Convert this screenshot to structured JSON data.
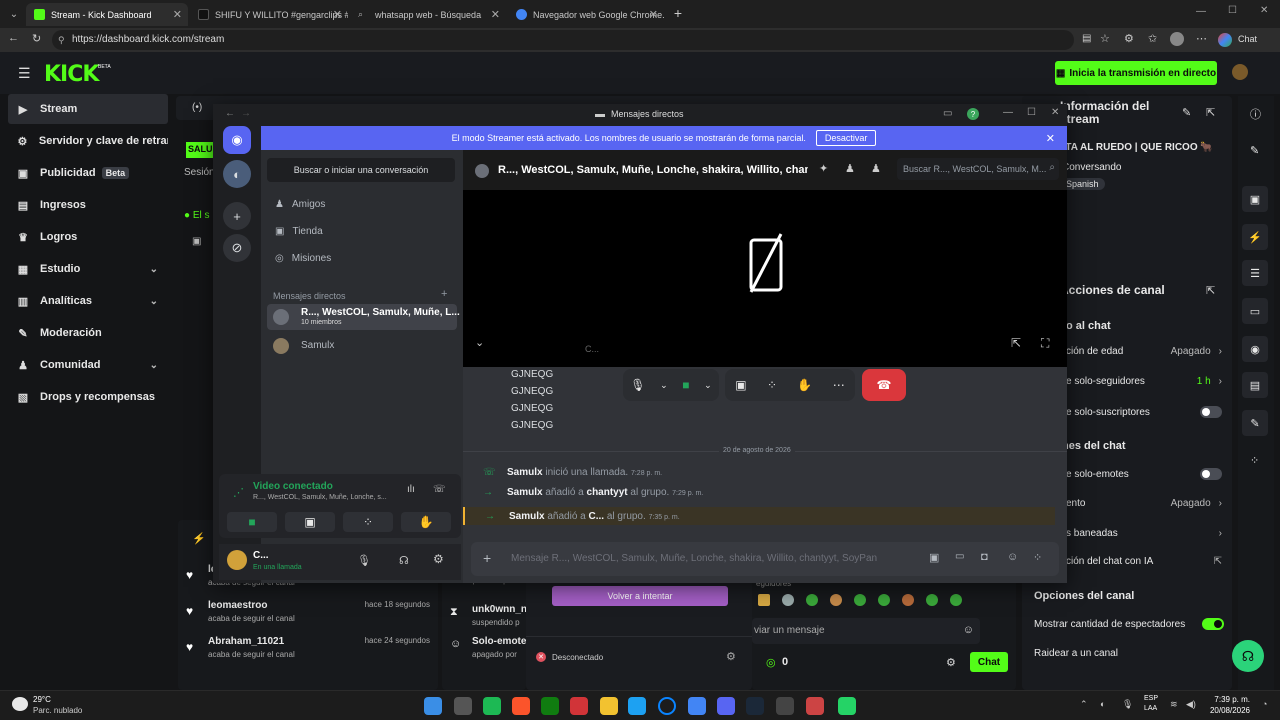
{
  "browser": {
    "tabs": [
      {
        "title": "Stream - Kick Dashboard",
        "color": "#53fc18"
      },
      {
        "title": "SHIFU Y WILLITO #gengarclips #...",
        "color": "#111111"
      },
      {
        "title": "whatsapp web - Búsqueda",
        "color": "#3c3c3c"
      },
      {
        "title": "Navegador web Google Chrome...",
        "color": "#4285f4"
      }
    ],
    "url": "https://dashboard.kick.com/stream",
    "chat_label": "Chat"
  },
  "kick": {
    "logo": "KICK",
    "logo_badge": "BETA",
    "go_live": "Inicia la transmisión en directo",
    "nav": [
      {
        "label": "Stream",
        "icon": "▶"
      },
      {
        "label": "Servidor y clave de retrans",
        "icon": "⚙"
      },
      {
        "label": "Publicidad",
        "icon": "▣",
        "badge": "Beta"
      },
      {
        "label": "Ingresos",
        "icon": "▤"
      },
      {
        "label": "Logros",
        "icon": "♛"
      },
      {
        "label": "Estudio",
        "icon": "▦"
      },
      {
        "label": "Analíticas",
        "icon": "▥"
      },
      {
        "label": "Moderación",
        "icon": "✎"
      },
      {
        "label": "Comunidad",
        "icon": "♟"
      },
      {
        "label": "Drops y recompensas",
        "icon": "▧"
      }
    ],
    "mid": {
      "salu": "SALU",
      "sesion": "Sesión",
      "el_s": "El s"
    },
    "stream_info": {
      "title": "Información del stream",
      "stream_title": "LTA AL RUEDO | QUE RICOO 🐂",
      "category": "Conversando",
      "language": "Spanish"
    },
    "channel_actions": {
      "title": "Acciones de canal",
      "section_chat": "o al chat",
      "rows": [
        {
          "label": "ción de edad",
          "value": "Apagado",
          "type": "chev"
        },
        {
          "label": "e solo-seguidores",
          "value": "1 h",
          "type": "chev"
        },
        {
          "label": "e solo-suscriptores",
          "type": "toggle"
        }
      ],
      "section_options": "nes del chat",
      "rows2": [
        {
          "label": "e solo-emotes",
          "type": "toggle"
        },
        {
          "label": "ento",
          "value": "Apagado",
          "type": "chev"
        },
        {
          "label": "s baneadas",
          "type": "chev"
        },
        {
          "label": "ción del chat con IA",
          "type": "ext"
        }
      ],
      "section_channel": "Opciones del canal",
      "rows3": [
        {
          "label": "Mostrar cantidad de espectadores",
          "type": "toggle-on"
        },
        {
          "label": "Raidear a un canal",
          "type": "none"
        }
      ]
    },
    "activity": [
      {
        "user": "le",
        "action": "acaba de seguir el canal",
        "time": ""
      },
      {
        "user": "leomaestroo",
        "action": "acaba de seguir el canal",
        "time": "hace 18 segundos"
      },
      {
        "user": "Abraham_11021",
        "action": "acaba de seguir el canal",
        "time": "hace 24 segundos"
      }
    ],
    "mod_log": [
      {
        "user": "unk0wnn_n",
        "action": "suspendido p"
      },
      {
        "user": "Solo-emote",
        "action": "apagado por"
      }
    ],
    "suspended_top": "suspendido po",
    "followers_top": "eguidores",
    "retry": "Volver a intentar",
    "disconnected": "Desconectado",
    "chat_placeholder": "viar un mensaje",
    "viewers": "0",
    "chat_button": "Chat"
  },
  "discord": {
    "window_title": "Mensajes directos",
    "banner_text": "El modo Streamer está activado. Los nombres de usuario se mostrarán de forma parcial.",
    "banner_button": "Desactivar",
    "search_placeholder": "Buscar o iniciar una conversación",
    "menu": [
      {
        "label": "Amigos"
      },
      {
        "label": "Tienda"
      },
      {
        "label": "Misiones"
      }
    ],
    "dm_header": "Mensajes directos",
    "dms": [
      {
        "name": "R..., WestCOL, Samulx, Muñe, L...",
        "sub": "10 miembros"
      },
      {
        "name": "Samulx",
        "sub": ""
      }
    ],
    "group_title": "R..., WestCOL, Samulx, Muñe, Lonche, shakira, Willito, chantyyt, Soy",
    "search_group": "Buscar R..., WestCOL, Samulx, M...",
    "video_user": "C...",
    "voice": {
      "status": "Video conectado",
      "channel": "R..., WestCOL, Samulx, Muñe, Lonche, s..."
    },
    "user": {
      "name": "C...",
      "status": "En una llamada"
    },
    "messages": [
      "GJNEQG",
      "GJNEQG",
      "GJNEQG",
      "GJNEQG"
    ],
    "date_divider": "20 de agosto de 2026",
    "events": [
      {
        "user": "Samulx",
        "text": "inició una llamada.",
        "target": "",
        "suffix": "",
        "time": "7:28 p. m.",
        "icon": "phone"
      },
      {
        "user": "Samulx",
        "text": "añadió a",
        "target": "chantyyt",
        "suffix": "al grupo.",
        "time": "7:29 p. m.",
        "icon": "arrow"
      },
      {
        "user": "Samulx",
        "text": "añadió a",
        "target": "C...",
        "suffix": "al grupo.",
        "time": "7:35 p. m.",
        "icon": "arrow"
      }
    ],
    "composer_placeholder": "Mensaje R..., WestCOL, Samulx, Muñe, Lonche, shakira, Willito, chantyyt, SoyPan"
  },
  "taskbar": {
    "weather_temp": "29°C",
    "weather_desc": "Parc. nublado",
    "lang1": "ESP",
    "lang2": "LAA",
    "time": "7:39 p. m.",
    "date": "20/08/2026"
  }
}
